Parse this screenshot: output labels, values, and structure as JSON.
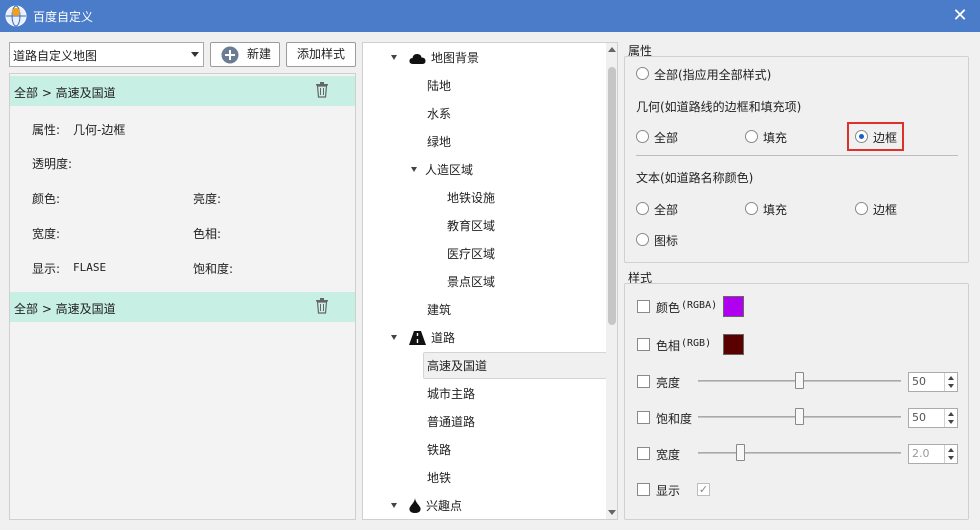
{
  "window": {
    "title": "百度自定义",
    "close_glyph": "✕"
  },
  "left": {
    "map_select": "道路自定义地图",
    "new_button": "新建",
    "add_style_button": "添加样式",
    "groups": [
      {
        "header": "全部 > 高速及国道",
        "attr_label": "属性:",
        "attr_value": "几何-边框",
        "opacity_label": "透明度:",
        "color_label": "颜色:",
        "brightness_label": "亮度:",
        "width_label": "宽度:",
        "hue_label": "色相:",
        "display_label": "显示:",
        "display_value": "FLASE",
        "saturation_label": "饱和度:"
      },
      {
        "header": "全部 > 高速及国道"
      }
    ]
  },
  "tree": {
    "items": [
      {
        "label": "地图背景",
        "icon": "cloud-icon"
      },
      {
        "label": "陆地"
      },
      {
        "label": "水系"
      },
      {
        "label": "绿地"
      },
      {
        "label": "人造区域"
      },
      {
        "label": "地铁设施"
      },
      {
        "label": "教育区域"
      },
      {
        "label": "医疗区域"
      },
      {
        "label": "景点区域"
      },
      {
        "label": "建筑"
      },
      {
        "label": "道路",
        "icon": "road-icon"
      },
      {
        "label": "高速及国道",
        "selected": true
      },
      {
        "label": "城市主路"
      },
      {
        "label": "普通道路"
      },
      {
        "label": "铁路"
      },
      {
        "label": "地铁"
      },
      {
        "label": "兴趣点",
        "icon": "poi-drop-icon"
      }
    ]
  },
  "props": {
    "section_title": "属性",
    "all_apply": "全部(指应用全部样式)",
    "geometry_title": "几何(如道路线的边框和填充项)",
    "geo_all": "全部",
    "geo_fill": "填充",
    "geo_border": "边框",
    "text_title": "文本(如道路名称颜色)",
    "text_all": "全部",
    "text_fill": "填充",
    "text_border": "边框",
    "text_icon": "图标",
    "selected_option": "geo_border"
  },
  "style": {
    "section_title": "样式",
    "color_label": "颜色",
    "color_suffix": "(RGBA)",
    "color_value": "#b000f0",
    "hue_label": "色相",
    "hue_suffix": "(RGB)",
    "hue_value": "#5a0000",
    "brightness_label": "亮度",
    "brightness_value": "50",
    "brightness_level": 0.5,
    "saturation_label": "饱和度",
    "saturation_value": "50",
    "saturation_level": 0.5,
    "width_label": "宽度",
    "width_value": "2.0",
    "display_label": "显示",
    "display_check": "✓"
  }
}
